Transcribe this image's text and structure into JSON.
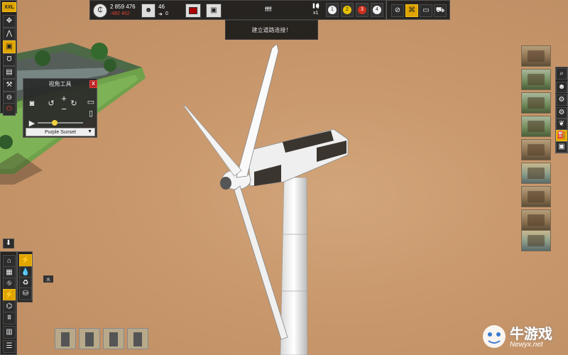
{
  "topbar": {
    "money": "2 859 476",
    "money_change": "-482 462",
    "people_count": "46",
    "people_change": "0",
    "center_label": "ffff",
    "speed": "x1",
    "player_slots": [
      "1",
      "2",
      "3",
      "4"
    ],
    "player_colors": [
      "#f0f0f0",
      "#e8c200",
      "#d03020",
      "#f0f0f0"
    ]
  },
  "notification": {
    "text": "建立道路连接！"
  },
  "camera_tool": {
    "title": "视角工具",
    "preset": "Purple Sunset",
    "close_label": "X"
  },
  "left_toolbar": {
    "logo": "XXL",
    "icons": [
      "move-icon",
      "compass-icon",
      "camera-icon",
      "magnet-icon",
      "save-icon",
      "wrench-icon",
      "no-entry-icon",
      "power-icon"
    ]
  },
  "bottom_menu": {
    "tooltip": "水",
    "icons": [
      "house-icon",
      "factory-icon",
      "road-icon",
      "farm-icon",
      "industry-icon",
      "government-icon",
      "park-icon",
      "trash-icon"
    ],
    "sub_icons": [
      "lightning-icon",
      "water-drop-icon",
      "recycle-icon",
      "cylinder-icon"
    ]
  },
  "build_slots": [
    {
      "name": "wind-turbine-slot",
      "count": ""
    },
    {
      "name": "pylon-slot",
      "count": ""
    },
    {
      "name": "plant-slot",
      "count": ""
    },
    {
      "name": "pipe-slot",
      "count": ""
    }
  ],
  "right_toolbar": {
    "icons": [
      "search-icon",
      "people-icon",
      "settings-icon",
      "gear-icon",
      "leaf-icon",
      "oil-derrick-icon",
      "bus-icon"
    ]
  },
  "watermark": {
    "text": "牛游戏",
    "url": "Newyx.net"
  }
}
